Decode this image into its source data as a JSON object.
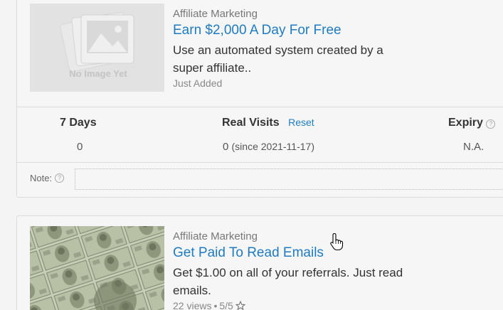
{
  "listings": [
    {
      "category": "Affiliate Marketing",
      "title": "Earn $2,000 A Day For Free",
      "description": "Use an automated system created by a super affiliate..",
      "meta": "Just Added",
      "image_placeholder": "No Image Yet",
      "stats": {
        "days_label": "7 Days",
        "days_value": "0",
        "visits_label": "Real Visits",
        "reset_label": "Reset",
        "visits_value": "0",
        "visits_since": "(since 2021-11-17)",
        "expiry_label": "Expiry",
        "expiry_value": "N.A."
      },
      "note_label": "Note:"
    },
    {
      "category": "Affiliate Marketing",
      "title": "Get Paid To Read Emails",
      "description": "Get $1.00 on all of your referrals. Just read emails.",
      "meta_views": "22 views",
      "meta_rating": "5/5"
    }
  ],
  "colors": {
    "link": "#1f7bc1",
    "card_bg": "#f6f6f6",
    "border": "#dcdcdc"
  },
  "icons": {
    "help": "question-circle-icon",
    "star": "star-outline-icon",
    "cursor": "hand-pointer-icon"
  }
}
